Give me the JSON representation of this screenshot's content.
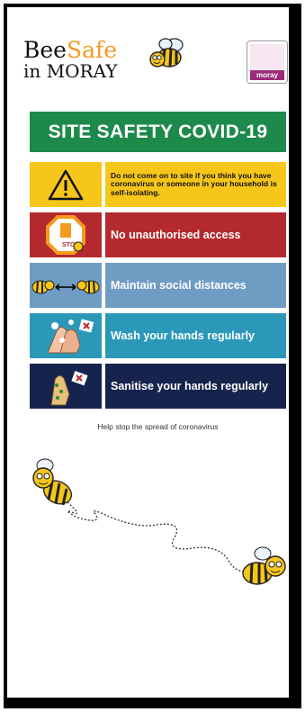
{
  "brand": {
    "bee": "Bee",
    "safe": "Safe",
    "line2": "in MORAY"
  },
  "partner_logo": {
    "text": "moray"
  },
  "title": "SITE SAFETY COVID-19",
  "rules": [
    {
      "icon": "warning-triangle-icon",
      "text": "Do not come on to site if you think you have coronavirus or someone in your household is self-isolating."
    },
    {
      "icon": "stop-sign-icon",
      "icon_label": "STOP",
      "text": "No unauthorised access"
    },
    {
      "icon": "bees-distance-icon",
      "text": "Maintain social distances"
    },
    {
      "icon": "hand-wash-icon",
      "text": "Wash your hands regularly"
    },
    {
      "icon": "hand-sanitise-icon",
      "text": "Sanitise your hands regularly"
    }
  ],
  "caption": "Help stop the spread of coronavirus",
  "colors": {
    "green": "#1d8a4b",
    "yellow": "#f6c61a",
    "red": "#b4292e",
    "lightblue": "#6f9cc3",
    "teal": "#2c98b9",
    "navy": "#16234d",
    "orange": "#f39a1f"
  }
}
